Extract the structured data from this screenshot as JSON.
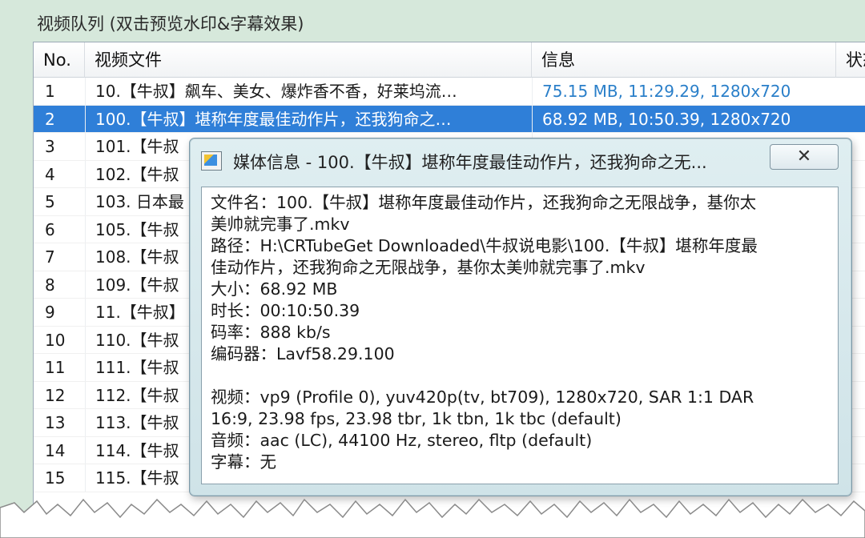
{
  "panel": {
    "title": "视频队列 (双击预览水印&字幕效果)"
  },
  "table": {
    "headers": [
      "No.",
      "视频文件",
      "信息",
      "状态"
    ],
    "rows": [
      {
        "no": "1",
        "file": "10.【牛叔】飙车、美女、爆炸香不香，好莱坞流…",
        "info": "75.15 MB, 11:29.29, 1280x720",
        "selected": false
      },
      {
        "no": "2",
        "file": "100.【牛叔】堪称年度最佳动作片，还我狗命之…",
        "info": "68.92 MB, 10:50.39, 1280x720",
        "selected": true
      },
      {
        "no": "3",
        "file": "101.【牛叔",
        "info": "",
        "selected": false
      },
      {
        "no": "4",
        "file": "102.【牛叔",
        "info": "",
        "selected": false
      },
      {
        "no": "5",
        "file": "103. 日本最",
        "info": "",
        "selected": false
      },
      {
        "no": "6",
        "file": "105.【牛叔",
        "info": "",
        "selected": false
      },
      {
        "no": "7",
        "file": "108.【牛叔",
        "info": "",
        "selected": false
      },
      {
        "no": "8",
        "file": "109.【牛叔",
        "info": "",
        "selected": false
      },
      {
        "no": "9",
        "file": "11.【牛叔】",
        "info": "",
        "selected": false
      },
      {
        "no": "10",
        "file": "110.【牛叔",
        "info": "",
        "selected": false
      },
      {
        "no": "11",
        "file": "111.【牛叔",
        "info": "",
        "selected": false
      },
      {
        "no": "12",
        "file": "112.【牛叔",
        "info": "",
        "selected": false
      },
      {
        "no": "13",
        "file": "113.【牛叔",
        "info": "",
        "selected": false
      },
      {
        "no": "14",
        "file": "114.【牛叔",
        "info": "",
        "selected": false
      },
      {
        "no": "15",
        "file": "115.【牛叔",
        "info": "",
        "selected": false
      }
    ]
  },
  "dialog": {
    "title": "媒体信息 - 100.【牛叔】堪称年度最佳动作片，还我狗命之无...",
    "close_icon": "close-icon",
    "lines": [
      "文件名：100.【牛叔】堪称年度最佳动作片，还我狗命之无限战争，基你太",
      "美帅就完事了.mkv",
      "路径：H:\\CRTubeGet Downloaded\\牛叔说电影\\100.【牛叔】堪称年度最",
      "佳动作片，还我狗命之无限战争，基你太美帅就完事了.mkv",
      "大小：68.92 MB",
      "时长：00:10:50.39",
      "码率：888 kb/s",
      "编码器：Lavf58.29.100",
      "",
      "视频：vp9 (Profile 0), yuv420p(tv, bt709), 1280x720, SAR 1:1 DAR",
      "16:9, 23.98 fps, 23.98 tbr, 1k tbn, 1k tbc (default)",
      "音频：aac (LC), 44100 Hz, stereo, fltp (default)",
      "字幕：无"
    ]
  },
  "colors": {
    "selection": "#2f7fd8",
    "info_text": "#2a7fc9",
    "panel_bg": "#d6e8db",
    "dialog_bg": "#d7e9ed"
  }
}
